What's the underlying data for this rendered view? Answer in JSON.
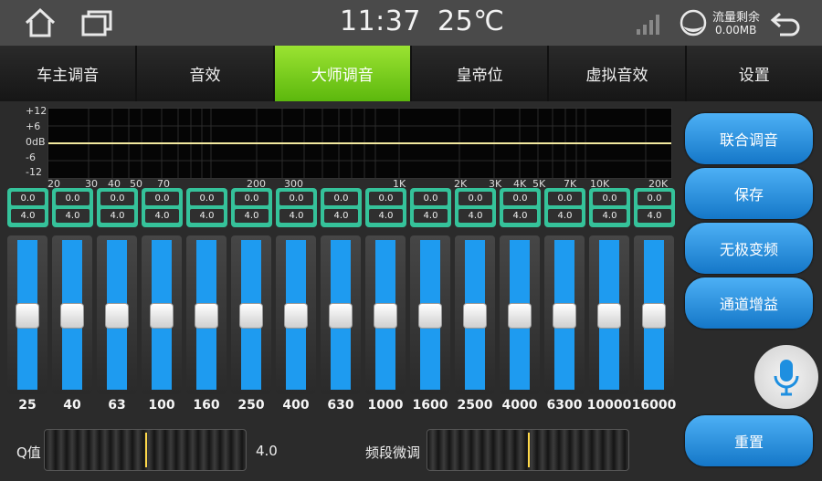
{
  "status": {
    "time": "11:37",
    "temperature": "25℃",
    "traffic_label": "流量剩余",
    "traffic_value": "0.00MB"
  },
  "tabs": [
    {
      "label": "车主调音",
      "active": false
    },
    {
      "label": "音效",
      "active": false
    },
    {
      "label": "大师调音",
      "active": true
    },
    {
      "label": "皇帝位",
      "active": false
    },
    {
      "label": "虚拟音效",
      "active": false
    },
    {
      "label": "设置",
      "active": false
    }
  ],
  "graph": {
    "db_labels": [
      "+12",
      "+6",
      "0dB",
      "-6",
      "-12"
    ],
    "freq_labels": [
      "20",
      "30",
      "40",
      "50",
      "70",
      "200",
      "300",
      "1K",
      "2K",
      "3K",
      "4K",
      "5K",
      "7K",
      "10K",
      "20K"
    ]
  },
  "bands": [
    {
      "freq": "25",
      "gain": "0.0",
      "q": "4.0"
    },
    {
      "freq": "40",
      "gain": "0.0",
      "q": "4.0"
    },
    {
      "freq": "63",
      "gain": "0.0",
      "q": "4.0"
    },
    {
      "freq": "100",
      "gain": "0.0",
      "q": "4.0"
    },
    {
      "freq": "160",
      "gain": "0.0",
      "q": "4.0"
    },
    {
      "freq": "250",
      "gain": "0.0",
      "q": "4.0"
    },
    {
      "freq": "400",
      "gain": "0.0",
      "q": "4.0"
    },
    {
      "freq": "630",
      "gain": "0.0",
      "q": "4.0"
    },
    {
      "freq": "1000",
      "gain": "0.0",
      "q": "4.0"
    },
    {
      "freq": "1600",
      "gain": "0.0",
      "q": "4.0"
    },
    {
      "freq": "2500",
      "gain": "0.0",
      "q": "4.0"
    },
    {
      "freq": "4000",
      "gain": "0.0",
      "q": "4.0"
    },
    {
      "freq": "6300",
      "gain": "0.0",
      "q": "4.0"
    },
    {
      "freq": "10000",
      "gain": "0.0",
      "q": "4.0"
    },
    {
      "freq": "16000",
      "gain": "0.0",
      "q": "4.0"
    }
  ],
  "side_buttons": {
    "link": "联合调音",
    "save": "保存",
    "stepless": "无极变频",
    "channel_gain": "通道增益",
    "reset": "重置"
  },
  "bottom": {
    "q_label": "Q值",
    "q_value": "4.0",
    "fine_tune_label": "频段微调"
  },
  "colors": {
    "accent_active_tab": "#7fd620",
    "slider_fill": "#1e9bf0",
    "value_box": "#35c29a",
    "button_blue": "#1e8fe0"
  }
}
